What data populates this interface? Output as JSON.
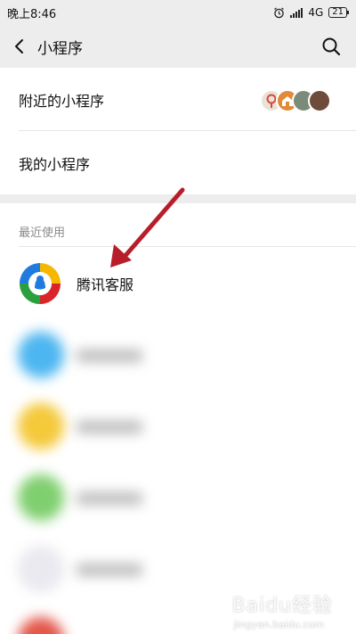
{
  "status_bar": {
    "time": "晚上8:46",
    "network": "4G",
    "battery": "21"
  },
  "nav": {
    "title": "小程序"
  },
  "menu": {
    "nearby_label": "附近的小程序",
    "mine_label": "我的小程序"
  },
  "recent": {
    "section_label": "最近使用",
    "items": [
      {
        "name": "腾讯客服"
      }
    ]
  },
  "watermark": {
    "brand": "Baidu经验",
    "url": "jingyan.baidu.com"
  },
  "colors": {
    "annotation_arrow": "#b81e2a",
    "background": "#ededed"
  }
}
